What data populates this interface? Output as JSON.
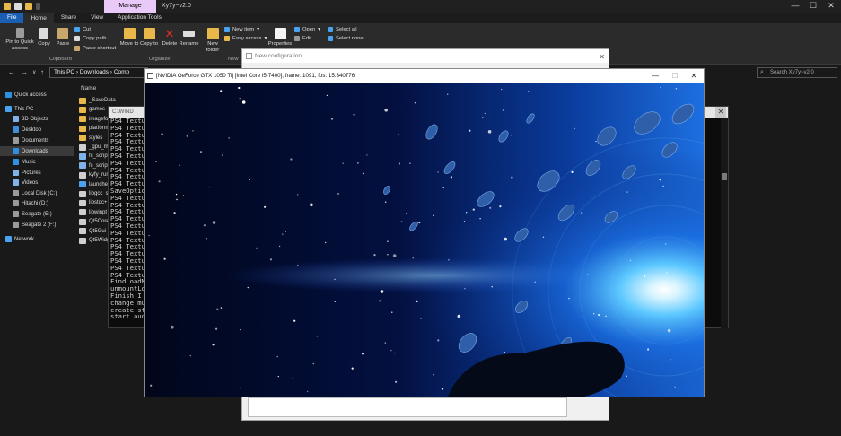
{
  "explorer": {
    "ribbon_context_tab": "Manage",
    "window_title": "Xy7y~v2.0",
    "window_controls": [
      "—",
      "☐",
      "✕"
    ],
    "tabs": [
      "File",
      "Home",
      "Share",
      "View",
      "Application Tools"
    ],
    "ribbon": {
      "pin_quick_access": "Pin to Quick access",
      "copy": "Copy",
      "paste": "Paste",
      "cut": "Cut",
      "copy_path": "Copy path",
      "paste_shortcut": "Paste shortcut",
      "move_to": "Move to",
      "copy_to": "Copy to",
      "delete": "Delete",
      "rename": "Rename",
      "new_folder": "New folder",
      "new_item": "New item",
      "easy_access": "Easy access",
      "properties": "Properties",
      "open": "Open",
      "edit": "Edit",
      "select_all": "Select all",
      "select_none": "Select none",
      "groups": {
        "clipboard": "Clipboard",
        "organize": "Organize",
        "new": "New"
      }
    },
    "address_path": "This PC  ›  Downloads  ›  Comp",
    "search_placeholder": "Search Xy7y~v2.0",
    "sidebar": [
      {
        "label": "Quick access",
        "icon": "star-icon",
        "color": "#2f8fe0"
      },
      {
        "label": "This PC",
        "icon": "pc-icon",
        "color": "#4aa3f0"
      },
      {
        "label": "3D Objects",
        "icon": "cube-icon",
        "color": "#7fb2e8"
      },
      {
        "label": "Desktop",
        "icon": "desktop-icon",
        "color": "#3f8fd8"
      },
      {
        "label": "Documents",
        "icon": "documents-icon",
        "color": "#9a9a9a"
      },
      {
        "label": "Downloads",
        "icon": "download-icon",
        "color": "#2f8fe0"
      },
      {
        "label": "Music",
        "icon": "music-icon",
        "color": "#2f8fe0"
      },
      {
        "label": "Pictures",
        "icon": "pictures-icon",
        "color": "#7fb2e8"
      },
      {
        "label": "Videos",
        "icon": "videos-icon",
        "color": "#7fb2e8"
      },
      {
        "label": "Local Disk (C:)",
        "icon": "drive-icon",
        "color": "#9a9a9a"
      },
      {
        "label": "Hitachi (D:)",
        "icon": "drive-icon",
        "color": "#9a9a9a"
      },
      {
        "label": "Seagate (E:)",
        "icon": "drive-icon",
        "color": "#9a9a9a"
      },
      {
        "label": "Seagate 2 (F:)",
        "icon": "drive-icon",
        "color": "#9a9a9a"
      },
      {
        "label": "Network",
        "icon": "network-icon",
        "color": "#4aa3f0"
      }
    ],
    "column_header": "Name",
    "files": [
      {
        "name": "_SaveData",
        "icon": "folder-icon",
        "color": "#e8b84a"
      },
      {
        "name": "games",
        "icon": "folder-icon",
        "color": "#e8b84a"
      },
      {
        "name": "imageformats",
        "icon": "folder-icon",
        "color": "#e8b84a"
      },
      {
        "name": "platforms",
        "icon": "folder-icon",
        "color": "#e8b84a"
      },
      {
        "name": "styles",
        "icon": "folder-icon",
        "color": "#e8b84a"
      },
      {
        "name": "_gpu_m",
        "icon": "file-icon",
        "color": "#cfcfcf"
      },
      {
        "name": "fc_script",
        "icon": "script-icon",
        "color": "#7fb2e8"
      },
      {
        "name": "fc_script",
        "icon": "script-icon",
        "color": "#7fb2e8"
      },
      {
        "name": "kyfy_run",
        "icon": "file-icon",
        "color": "#cfcfcf"
      },
      {
        "name": "launcher",
        "icon": "app-icon",
        "color": "#4aa3f0"
      },
      {
        "name": "libgcc_s",
        "icon": "file-icon",
        "color": "#cfcfcf"
      },
      {
        "name": "libstdc+",
        "icon": "file-icon",
        "color": "#cfcfcf"
      },
      {
        "name": "libwinpt",
        "icon": "file-icon",
        "color": "#cfcfcf"
      },
      {
        "name": "Qt5Core",
        "icon": "file-icon",
        "color": "#cfcfcf"
      },
      {
        "name": "Qt5Gui",
        "icon": "file-icon",
        "color": "#cfcfcf"
      },
      {
        "name": "Qt5Widg",
        "icon": "file-icon",
        "color": "#cfcfcf"
      }
    ]
  },
  "console": {
    "title": "C:\\WIND",
    "close_glyph": "✕",
    "lines": [
      "PS4 Textur",
      "PS4 Textur",
      "PS4 Textur",
      "PS4 Textur",
      "PS4 Textur",
      "PS4 Textur",
      "PS4 Textur",
      "PS4 Textur",
      "PS4 Textur",
      "PS4 Textur",
      "SaveOption",
      "PS4 Textur",
      "PS4 Textur",
      "PS4 Textur",
      "PS4 Textur",
      "PS4 Textur",
      "PS4 Textur",
      "PS4 Textur",
      "PS4 Textur",
      "PS4 Textur",
      "PS4 Textur",
      "PS4 Textur",
      "PS4 Textur",
      "FindLoadMo",
      "unmountLoa",
      "Finish I a",
      "change mus",
      "create str",
      "start audi"
    ]
  },
  "config_dialog": {
    "title": "New configuration",
    "close_glyph": "✕"
  },
  "game_window": {
    "title": "[NVIDIA GeForce GTX 1050 Ti] [Intel Core i5-7400], frame: 1091, fps: 15.340776",
    "controls": [
      "—",
      "☐",
      "✕"
    ]
  },
  "colors": {
    "accent": "#1a5fb4",
    "context_tab": "#e8c9f7",
    "space_dark": "#020a24",
    "vortex": "#1e90ff"
  }
}
